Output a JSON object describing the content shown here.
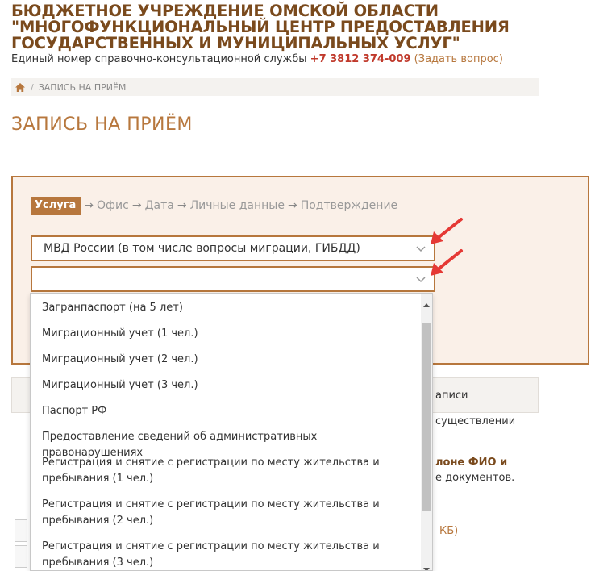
{
  "header": {
    "org_title": "БЮДЖЕТНОЕ УЧРЕЖДЕНИЕ ОМСКОЙ ОБЛАСТИ \"МНОГОФУНКЦИОНАЛЬНЫЙ ЦЕНТР ПРЕДОСТАВЛЕНИЯ ГОСУДАРСТВЕННЫХ И МУНИЦИПАЛЬНЫХ УСЛУГ\"",
    "hotline_label": "Единый номер справочно-консультационной службы",
    "hotline_phone": "+7 3812 374-009",
    "ask_link": "(Задать вопрос)"
  },
  "breadcrumb": {
    "current": "ЗАПИСЬ НА ПРИЁМ"
  },
  "page_title": "ЗАПИСЬ НА ПРИЁМ",
  "steps": {
    "active": "Услуга",
    "arrow": "→",
    "items": [
      "Офис",
      "Дата",
      "Личные данные",
      "Подтверждение"
    ]
  },
  "selects": {
    "department_value": "МВД России (в том числе вопросы миграции, ГИБДД)",
    "service_value": ""
  },
  "dropdown_options": [
    "Загранпаспорт (на 5 лет)",
    "Миграционный учет (1 чел.)",
    "Миграционный учет (2 чел.)",
    "Миграционный учет (3 чел.)",
    "Паспорт РФ",
    "Предоставление сведений об административных правонарушениях",
    "Регистрация и снятие с регистрации по месту жительства и пребывания (1 чел.)",
    "Регистрация и снятие с регистрации по месту жительства и пребывания (2 чел.)",
    "Регистрация и снятие с регистрации по месту жительства и пребывания (3 чел.)"
  ],
  "background": {
    "tab_text": "аписи",
    "line1": "существлении",
    "line2_bold": "лоне ФИО и",
    "line3": "е документов.",
    "file_size": "КБ)"
  },
  "colors": {
    "brand_dark": "#7a4a1d",
    "accent": "#b7773d",
    "phone": "#c0392b",
    "panel_bg": "#faf0e8",
    "annotation_arrow": "#e53935"
  }
}
